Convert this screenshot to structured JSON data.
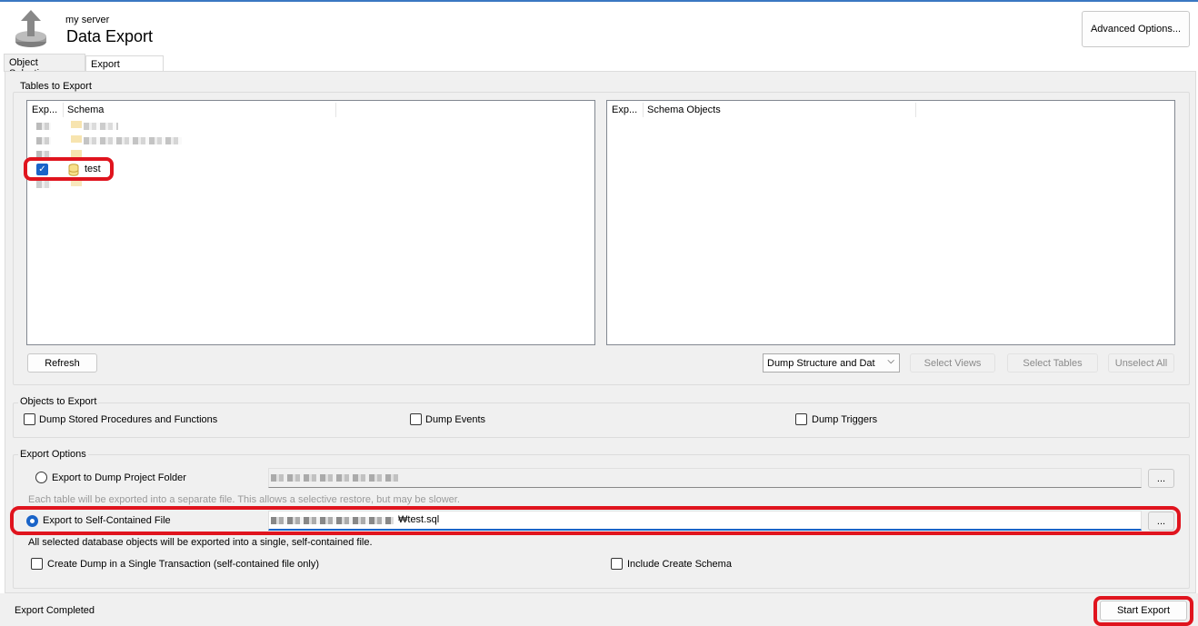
{
  "header": {
    "server": "my server",
    "title": "Data Export",
    "advanced_options": "Advanced Options...",
    "icon": "export-upload-icon"
  },
  "tabs": [
    {
      "label": "Object Selection",
      "active": true
    },
    {
      "label": "Export Progress",
      "active": false
    }
  ],
  "tables_to_export": {
    "label": "Tables to Export",
    "schema_list": {
      "col_export": "Exp...",
      "col_schema": "Schema",
      "rows": [
        {
          "name": "test",
          "checked": true
        }
      ]
    },
    "objects_list": {
      "col_export": "Exp...",
      "col_objects": "Schema Objects"
    },
    "refresh": "Refresh",
    "dump_mode": "Dump Structure and Dat",
    "select_views": "Select Views",
    "select_tables": "Select Tables",
    "unselect_all": "Unselect All"
  },
  "objects_to_export": {
    "label": "Objects to Export",
    "routines": "Dump Stored Procedures and Functions",
    "events": "Dump Events",
    "triggers": "Dump Triggers"
  },
  "export_options": {
    "label": "Export Options",
    "dump_folder": "Export to Dump Project Folder",
    "dump_folder_hint": "Each table will be exported into a separate file. This allows a selective restore, but may be slower.",
    "self_contained": "Export to Self-Contained File",
    "self_contained_path": "₩test.sql",
    "self_contained_hint": "All selected database objects will be exported into a single, self-contained file.",
    "browse": "...",
    "single_transaction": "Create Dump in a Single Transaction (self-contained file only)",
    "include_schema": "Include Create Schema",
    "selected": "self_contained"
  },
  "footer": {
    "status": "Export Completed",
    "start_export": "Start Export"
  },
  "colors": {
    "accent": "#1a64c8",
    "highlight": "#e0141e"
  }
}
